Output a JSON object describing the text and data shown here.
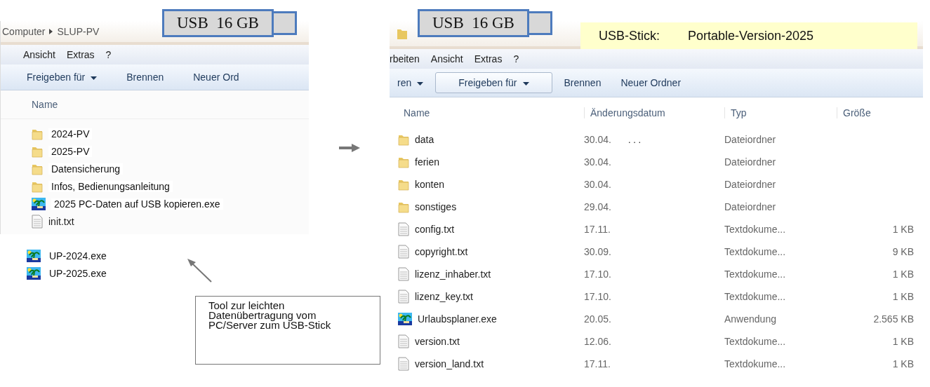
{
  "left_window": {
    "breadcrumb": [
      "Computer",
      "SLUP-PV"
    ],
    "usb_label": "USB  16 GB",
    "menu": [
      "Ansicht",
      "Extras",
      "?"
    ],
    "toolbar": [
      {
        "label": "Freigeben für",
        "dropdown": true,
        "selected": false
      },
      {
        "label": "Brennen",
        "dropdown": false,
        "selected": false
      },
      {
        "label": "Neuer Ord",
        "dropdown": false,
        "selected": false
      }
    ],
    "column": "Name",
    "items": [
      {
        "name": "2024-PV",
        "kind": "folder"
      },
      {
        "name": "2025-PV",
        "kind": "folder"
      },
      {
        "name": "Datensicherung",
        "kind": "folder"
      },
      {
        "name": "Infos, Bedienungsanleitung",
        "kind": "folder"
      },
      {
        "name": "2025 PC-Daten auf USB kopieren.exe",
        "kind": "exe"
      },
      {
        "name": "init.txt",
        "kind": "txt"
      }
    ]
  },
  "loose_files": [
    {
      "name": "UP-2024.exe",
      "kind": "exe"
    },
    {
      "name": "UP-2025.exe",
      "kind": "exe"
    }
  ],
  "callout": "Tool zur leichten Datenübertragung vom PC/Server zum USB-Stick",
  "right_window": {
    "usb_label": "USB  16 GB",
    "note": {
      "label": "USB-Stick:",
      "value": "Portable-Version-2025"
    },
    "menu": [
      "rbeiten",
      "Ansicht",
      "Extras",
      "?"
    ],
    "toolbar": [
      {
        "label": "ren",
        "dropdown": true,
        "selected": false
      },
      {
        "label": "Freigeben für",
        "dropdown": true,
        "selected": true
      },
      {
        "label": "Brennen",
        "dropdown": false,
        "selected": false
      },
      {
        "label": "Neuer Ordner",
        "dropdown": false,
        "selected": false
      }
    ],
    "columns": [
      "Name",
      "Änderungsdatum",
      "Typ",
      "Größe"
    ],
    "rows": [
      {
        "name": "data",
        "kind": "folder",
        "date": "30.04.",
        "time": ". . .",
        "type": "Dateiordner"
      },
      {
        "name": "ferien",
        "kind": "folder",
        "date": "30.04.",
        "type": "Dateiordner"
      },
      {
        "name": "konten",
        "kind": "folder",
        "date": "30.04.",
        "type": "Dateiordner"
      },
      {
        "name": "sonstiges",
        "kind": "folder",
        "date": "29.04.",
        "type": "Dateiordner"
      },
      {
        "name": "config.txt",
        "kind": "txt",
        "date": "17.11.",
        "type": "Textdokume...",
        "size": "1 KB"
      },
      {
        "name": "copyright.txt",
        "kind": "txt",
        "date": "30.09.",
        "type": "Textdokume...",
        "size": "9 KB"
      },
      {
        "name": "lizenz_inhaber.txt",
        "kind": "txt",
        "date": "17.10.",
        "type": "Textdokume...",
        "size": "1 KB"
      },
      {
        "name": "lizenz_key.txt",
        "kind": "txt",
        "date": "17.10.",
        "type": "Textdokume...",
        "size": "1 KB"
      },
      {
        "name": "Urlaubsplaner.exe",
        "kind": "exe",
        "date": "20.05.",
        "type": "Anwendung",
        "size": "2.565 KB"
      },
      {
        "name": "version.txt",
        "kind": "txt",
        "date": "12.06.",
        "type": "Textdokume...",
        "size": "1 KB"
      },
      {
        "name": "version_land.txt",
        "kind": "txt",
        "date": "17.11.",
        "type": "Textdokume...",
        "size": "1 KB"
      }
    ]
  }
}
